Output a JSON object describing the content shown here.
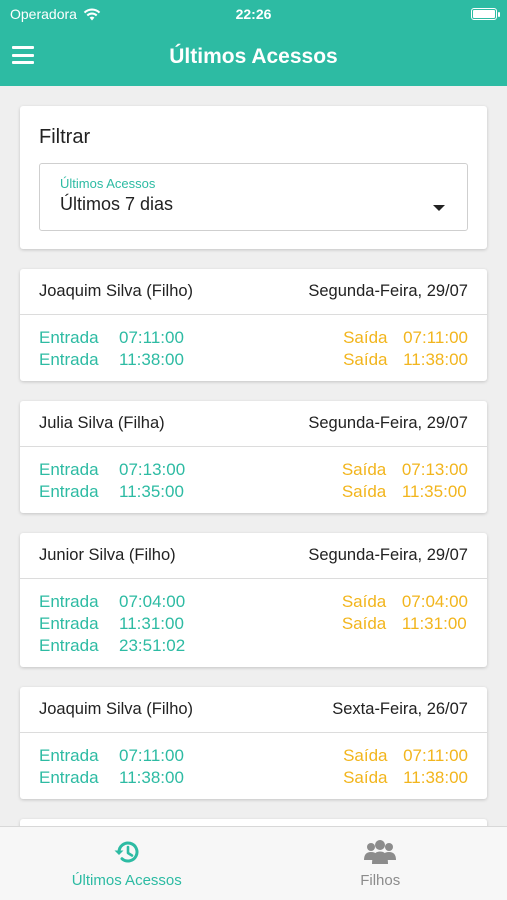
{
  "status_bar": {
    "carrier": "Operadora",
    "time": "22:26",
    "wifi_icon": "wifi-icon",
    "battery_icon": "battery-icon"
  },
  "header": {
    "title": "Últimos Acessos",
    "menu_icon": "hamburger-menu-icon"
  },
  "filter": {
    "title": "Filtrar",
    "select_label": "Últimos Acessos",
    "select_value": "Últimos 7 dias"
  },
  "accesses": [
    {
      "name": "Joaquim Silva (Filho)",
      "date": "Segunda-Feira, 29/07",
      "entries": [
        {
          "label": "Entrada",
          "time": "07:11:00"
        },
        {
          "label": "Entrada",
          "time": "11:38:00"
        }
      ],
      "exits": [
        {
          "label": "Saída",
          "time": "07:11:00"
        },
        {
          "label": "Saída",
          "time": "11:38:00"
        }
      ]
    },
    {
      "name": "Julia Silva (Filha)",
      "date": "Segunda-Feira, 29/07",
      "entries": [
        {
          "label": "Entrada",
          "time": "07:13:00"
        },
        {
          "label": "Entrada",
          "time": "11:35:00"
        }
      ],
      "exits": [
        {
          "label": "Saída",
          "time": "07:13:00"
        },
        {
          "label": "Saída",
          "time": "11:35:00"
        }
      ]
    },
    {
      "name": "Junior Silva (Filho)",
      "date": "Segunda-Feira, 29/07",
      "entries": [
        {
          "label": "Entrada",
          "time": "07:04:00"
        },
        {
          "label": "Entrada",
          "time": "11:31:00"
        },
        {
          "label": "Entrada",
          "time": "23:51:02"
        }
      ],
      "exits": [
        {
          "label": "Saída",
          "time": "07:04:00"
        },
        {
          "label": "Saída",
          "time": "11:31:00"
        }
      ]
    },
    {
      "name": "Joaquim Silva (Filho)",
      "date": "Sexta-Feira, 26/07",
      "entries": [
        {
          "label": "Entrada",
          "time": "07:11:00"
        },
        {
          "label": "Entrada",
          "time": "11:38:00"
        }
      ],
      "exits": [
        {
          "label": "Saída",
          "time": "07:11:00"
        },
        {
          "label": "Saída",
          "time": "11:38:00"
        }
      ]
    }
  ],
  "tabs": [
    {
      "label": "Últimos Acessos",
      "icon": "history-icon",
      "active": true
    },
    {
      "label": "Filhos",
      "icon": "group-icon",
      "active": false
    }
  ],
  "colors": {
    "primary": "#2dbba3",
    "exit": "#f2b51d",
    "inactive_tab": "#8c8c8c"
  }
}
